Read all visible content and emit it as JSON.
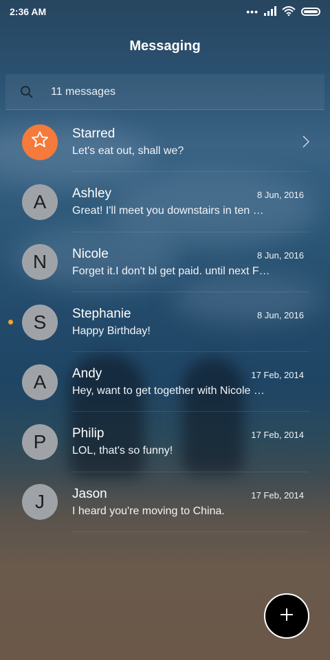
{
  "status_bar": {
    "time": "2:36 AM",
    "dots": "•••",
    "icons": [
      "signal-icon",
      "wifi-icon",
      "battery-icon"
    ]
  },
  "header": {
    "title": "Messaging"
  },
  "search": {
    "label": "11 messages",
    "icon": "search-icon"
  },
  "conversations": [
    {
      "name": "Starred",
      "preview": "Let's eat out, shall we?",
      "date": "",
      "avatar": "star-icon",
      "starred": true,
      "unread": false
    },
    {
      "name": "Ashley",
      "preview": "Great! I'll meet you downstairs in ten …",
      "date": "8 Jun, 2016",
      "avatar": "A",
      "unread": false
    },
    {
      "name": "Nicole",
      "preview": "Forget it.I don't bl get paid. until next F…",
      "date": "8 Jun, 2016",
      "avatar": "N",
      "unread": false
    },
    {
      "name": "Stephanie",
      "preview": "Happy Birthday!",
      "date": "8 Jun, 2016",
      "avatar": "S",
      "unread": true
    },
    {
      "name": "Andy",
      "preview": "Hey, want to get together with Nicole …",
      "date": "17 Feb, 2014",
      "avatar": "A",
      "unread": false
    },
    {
      "name": "Philip",
      "preview": "LOL, that's so funny!",
      "date": "17 Feb, 2014",
      "avatar": "P",
      "unread": false
    },
    {
      "name": "Jason",
      "preview": "I heard you're moving to China.",
      "date": "17 Feb, 2014",
      "avatar": "J",
      "unread": false
    }
  ],
  "fab": {
    "icon": "plus-icon"
  },
  "colors": {
    "starred_avatar": "#f47b3c",
    "avatar": "#9fa3a8",
    "unread_dot": "#f5a623",
    "fab": "#000000"
  }
}
